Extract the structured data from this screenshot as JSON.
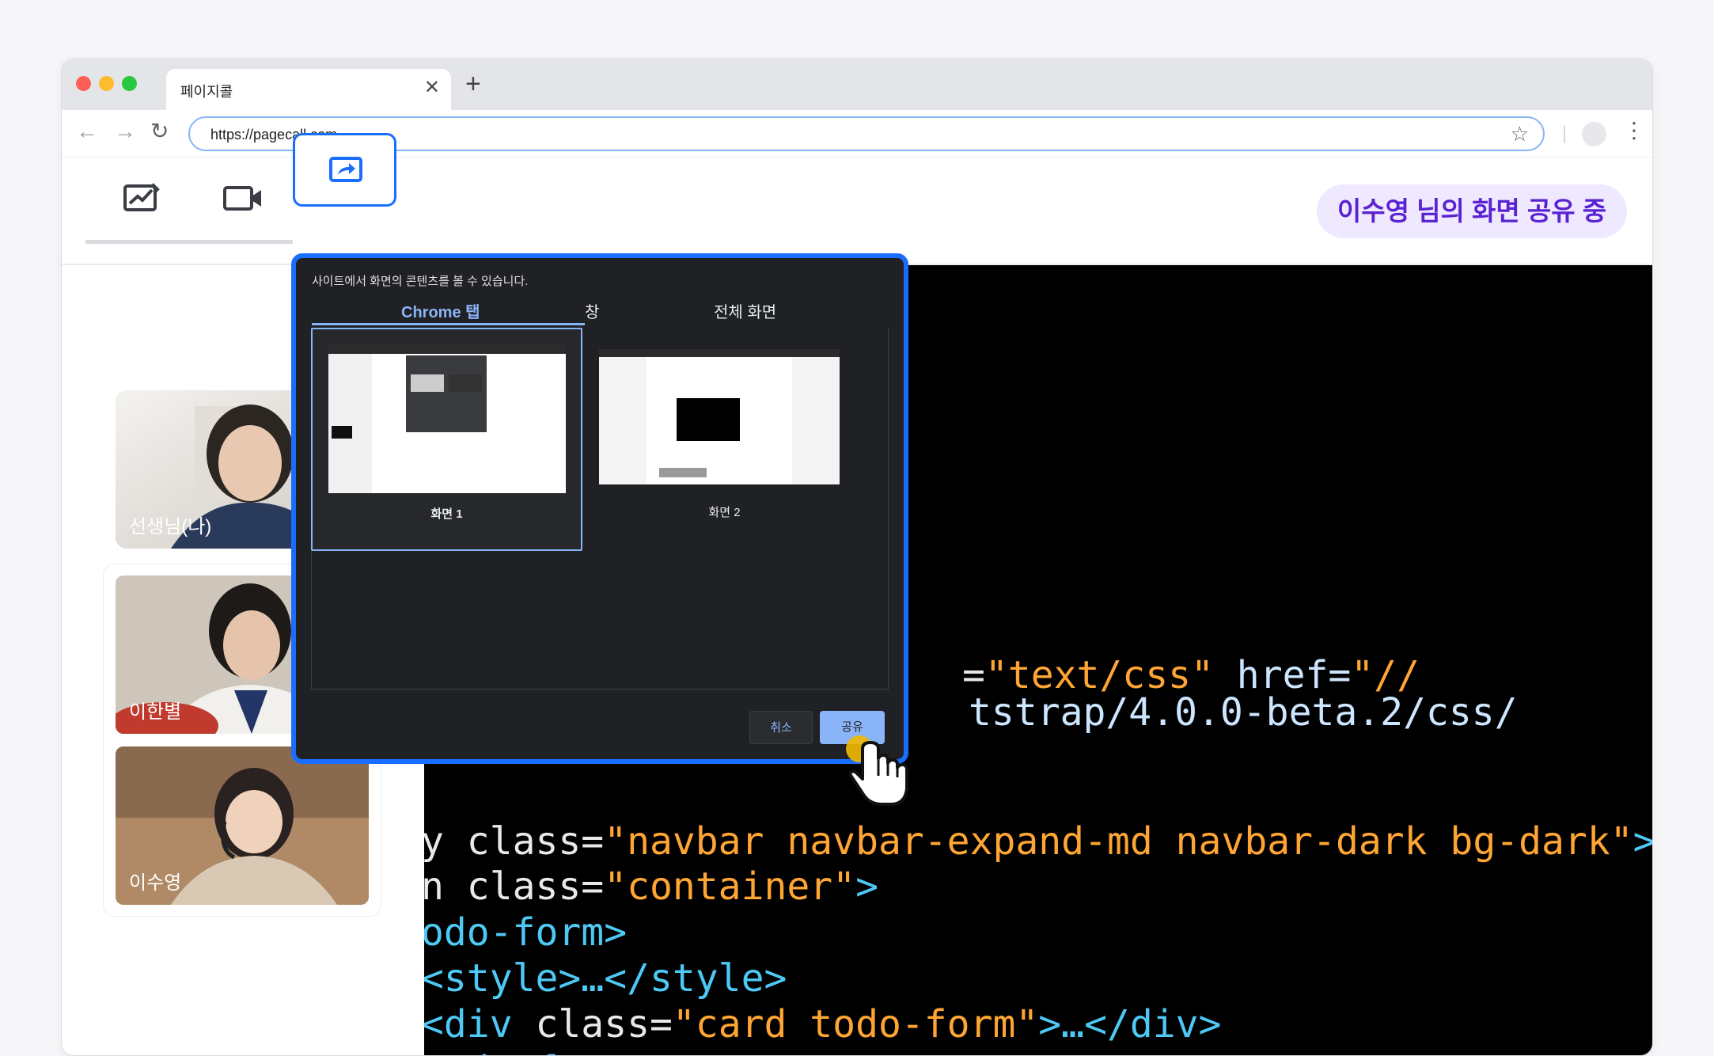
{
  "browser": {
    "tab_title": "페이지콜",
    "tab_close": "✕",
    "new_tab": "+",
    "url": "https://pagecall.com",
    "icons": [
      "back-icon",
      "forward-icon",
      "reload-icon",
      "star-icon",
      "profile-icon",
      "more-icon"
    ]
  },
  "toolbar": {
    "tools": [
      "whiteboard-icon",
      "video-icon",
      "screen-share-icon"
    ],
    "status_badge": "이수영 님의 화면 공유 중"
  },
  "participants": [
    {
      "name": "선생님(나)"
    },
    {
      "name": "이한별"
    },
    {
      "name": "이수영"
    }
  ],
  "dialog": {
    "heading": "사이트에서 화면의 콘텐츠를 볼 수 있습니다.",
    "tabs": [
      "Chrome 탭",
      "창",
      "전체 화면"
    ],
    "selected_tab": "Chrome 탭",
    "screens": [
      "화면 1",
      "화면 2"
    ],
    "selected_screen": "화면 1",
    "cancel_label": "취소",
    "share_label": "공유"
  },
  "code_lines": [
    {
      "a": "=",
      "s": "\"text/css\"",
      "b": " href=",
      "c": "\"//"
    },
    {
      "c": "tstrap/4.0.0-beta.2/css/"
    },
    {
      "a": "y class=",
      "s": "\"navbar navbar-expand-md navbar-dark bg-dark\"",
      "t": ">…</nav"
    },
    {
      "a": "n class=",
      "s": "\"container\"",
      "t": ">"
    },
    {
      "t": "odo-form>"
    },
    {
      "t": "<style>…</style>"
    },
    {
      "t": "<div",
      "a": " class=",
      "s": "\"card todo-form\"",
      "t2": ">…</div>"
    },
    {
      "t": "todo-form>"
    }
  ],
  "colors": {
    "accent": "#1a6eff",
    "badge_bg": "#efe9ff",
    "badge_text": "#5a22d1",
    "chrome_blue": "#8ab4f8"
  }
}
